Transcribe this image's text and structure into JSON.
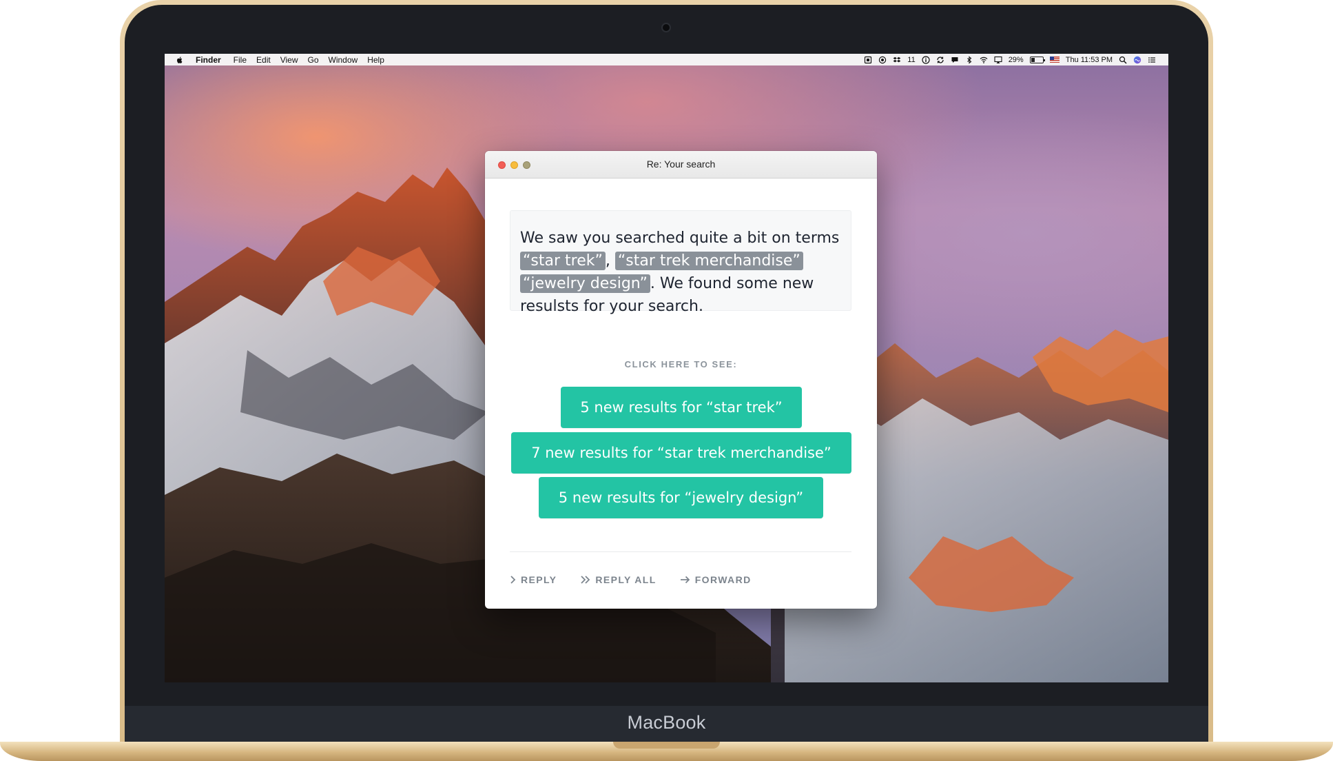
{
  "device": {
    "brand": "MacBook"
  },
  "menubar": {
    "app": "Finder",
    "items": [
      "File",
      "Edit",
      "View",
      "Go",
      "Window",
      "Help"
    ],
    "status": {
      "icons": [
        "ticket-icon",
        "target-icon",
        "dropbox-icon",
        "info-icon",
        "sync-icon",
        "chat-icon",
        "bluetooth-icon",
        "wifi-icon",
        "airplay-icon",
        "battery-icon",
        "flag-icon",
        "search-icon",
        "siri-icon",
        "list-icon"
      ],
      "badge_count": "11",
      "battery": "29%",
      "battery_level": 0.29,
      "clock": "Thu 11:53 PM"
    }
  },
  "window": {
    "title": "Re: Your search",
    "message": {
      "text_before": "We saw you searched quite a bit on terms",
      "terms": [
        "“star trek”",
        "“star trek merchandise”",
        "“jewelry design”"
      ],
      "comma": ",",
      "text_after": ". We found some new resulsts for your search."
    },
    "cta_label": "CLICK HERE TO SEE:",
    "results": [
      {
        "label": "5 new results for “star trek”"
      },
      {
        "label": "7 new results for “star trek merchandise”"
      },
      {
        "label": "5 new results for “jewelry design”"
      }
    ],
    "actions": {
      "reply": "REPLY",
      "reply_all": "REPLY ALL",
      "forward": "FORWARD"
    }
  },
  "colors": {
    "accent": "#23c4a4",
    "term_highlight": "#8a9199",
    "action_text": "#7c848d",
    "frame_gold": "#d9bb88"
  }
}
